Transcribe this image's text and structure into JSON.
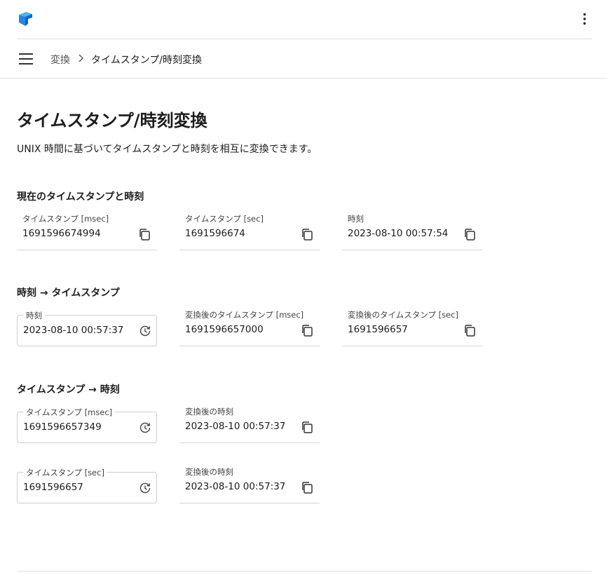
{
  "breadcrumb": {
    "parent": "変換",
    "current": "タイムスタンプ/時刻変換"
  },
  "page": {
    "title": "タイムスタンプ/時刻変換",
    "description": "UNIX 時間に基づいてタイムスタンプと時刻を相互に変換できます。"
  },
  "current_section": {
    "title": "現在のタイムスタンプと時刻",
    "fields": [
      {
        "label": "タイムスタンプ [msec]",
        "value": "1691596674994"
      },
      {
        "label": "タイムスタンプ [sec]",
        "value": "1691596674"
      },
      {
        "label": "時刻",
        "value": "2023-08-10 00:57:54"
      }
    ]
  },
  "time_to_ts_section": {
    "title": "時刻 → タイムスタンプ",
    "input": {
      "label": "時刻",
      "value": "2023-08-10 00:57:37"
    },
    "outputs": [
      {
        "label": "変換後のタイムスタンプ [msec]",
        "value": "1691596657000"
      },
      {
        "label": "変換後のタイムスタンプ [sec]",
        "value": "1691596657"
      }
    ]
  },
  "ts_to_time_section": {
    "title": "タイムスタンプ → 時刻",
    "rows": [
      {
        "input": {
          "label": "タイムスタンプ [msec]",
          "value": "1691596657349"
        },
        "output": {
          "label": "変換後の時刻",
          "value": "2023-08-10 00:57:37"
        }
      },
      {
        "input": {
          "label": "タイムスタンプ [sec]",
          "value": "1691596657"
        },
        "output": {
          "label": "変換後の時刻",
          "value": "2023-08-10 00:57:37"
        }
      }
    ]
  },
  "icons": {
    "logo": "brand-logo-icon",
    "more": "more-vert-icon",
    "menu": "hamburger-menu-icon",
    "separator": "chevron-right-icon",
    "copy": "copy-icon",
    "now": "clock-reset-icon"
  },
  "colors": {
    "brand": "#1e88e5",
    "text": "#1c1c1c",
    "divider": "#e0e0e0"
  }
}
